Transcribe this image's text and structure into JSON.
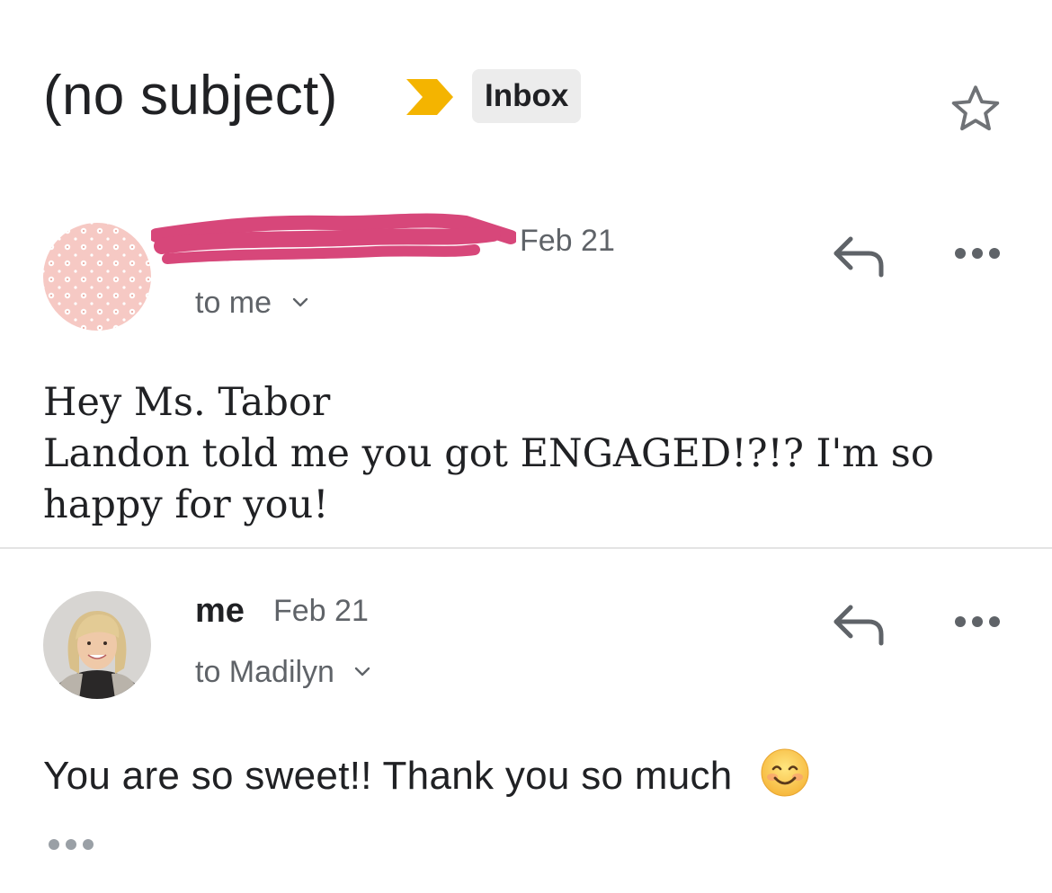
{
  "header": {
    "subject": "(no subject)",
    "label": "Inbox",
    "importance_color": "#F4B400",
    "star_icon": "star-outline-icon"
  },
  "messages": [
    {
      "sender_redacted": true,
      "redaction_color": "#D7477A",
      "date": "Feb 21",
      "recipient": "to me",
      "body_lines": [
        "Hey Ms. Tabor",
        "Landon told me you got ENGAGED!?!? I'm so happy for you!"
      ],
      "avatar": "floral-pattern-avatar"
    },
    {
      "sender": "me",
      "date": "Feb 21",
      "recipient": "to Madilyn",
      "body": "You are so sweet!! Thank you so much",
      "emoji": "smiling-face-icon",
      "avatar": "profile-photo-avatar"
    }
  ],
  "colors": {
    "text_primary": "#202124",
    "text_secondary": "#5F6368",
    "divider": "#E3E3E3",
    "chip_bg": "#ECECEC"
  }
}
